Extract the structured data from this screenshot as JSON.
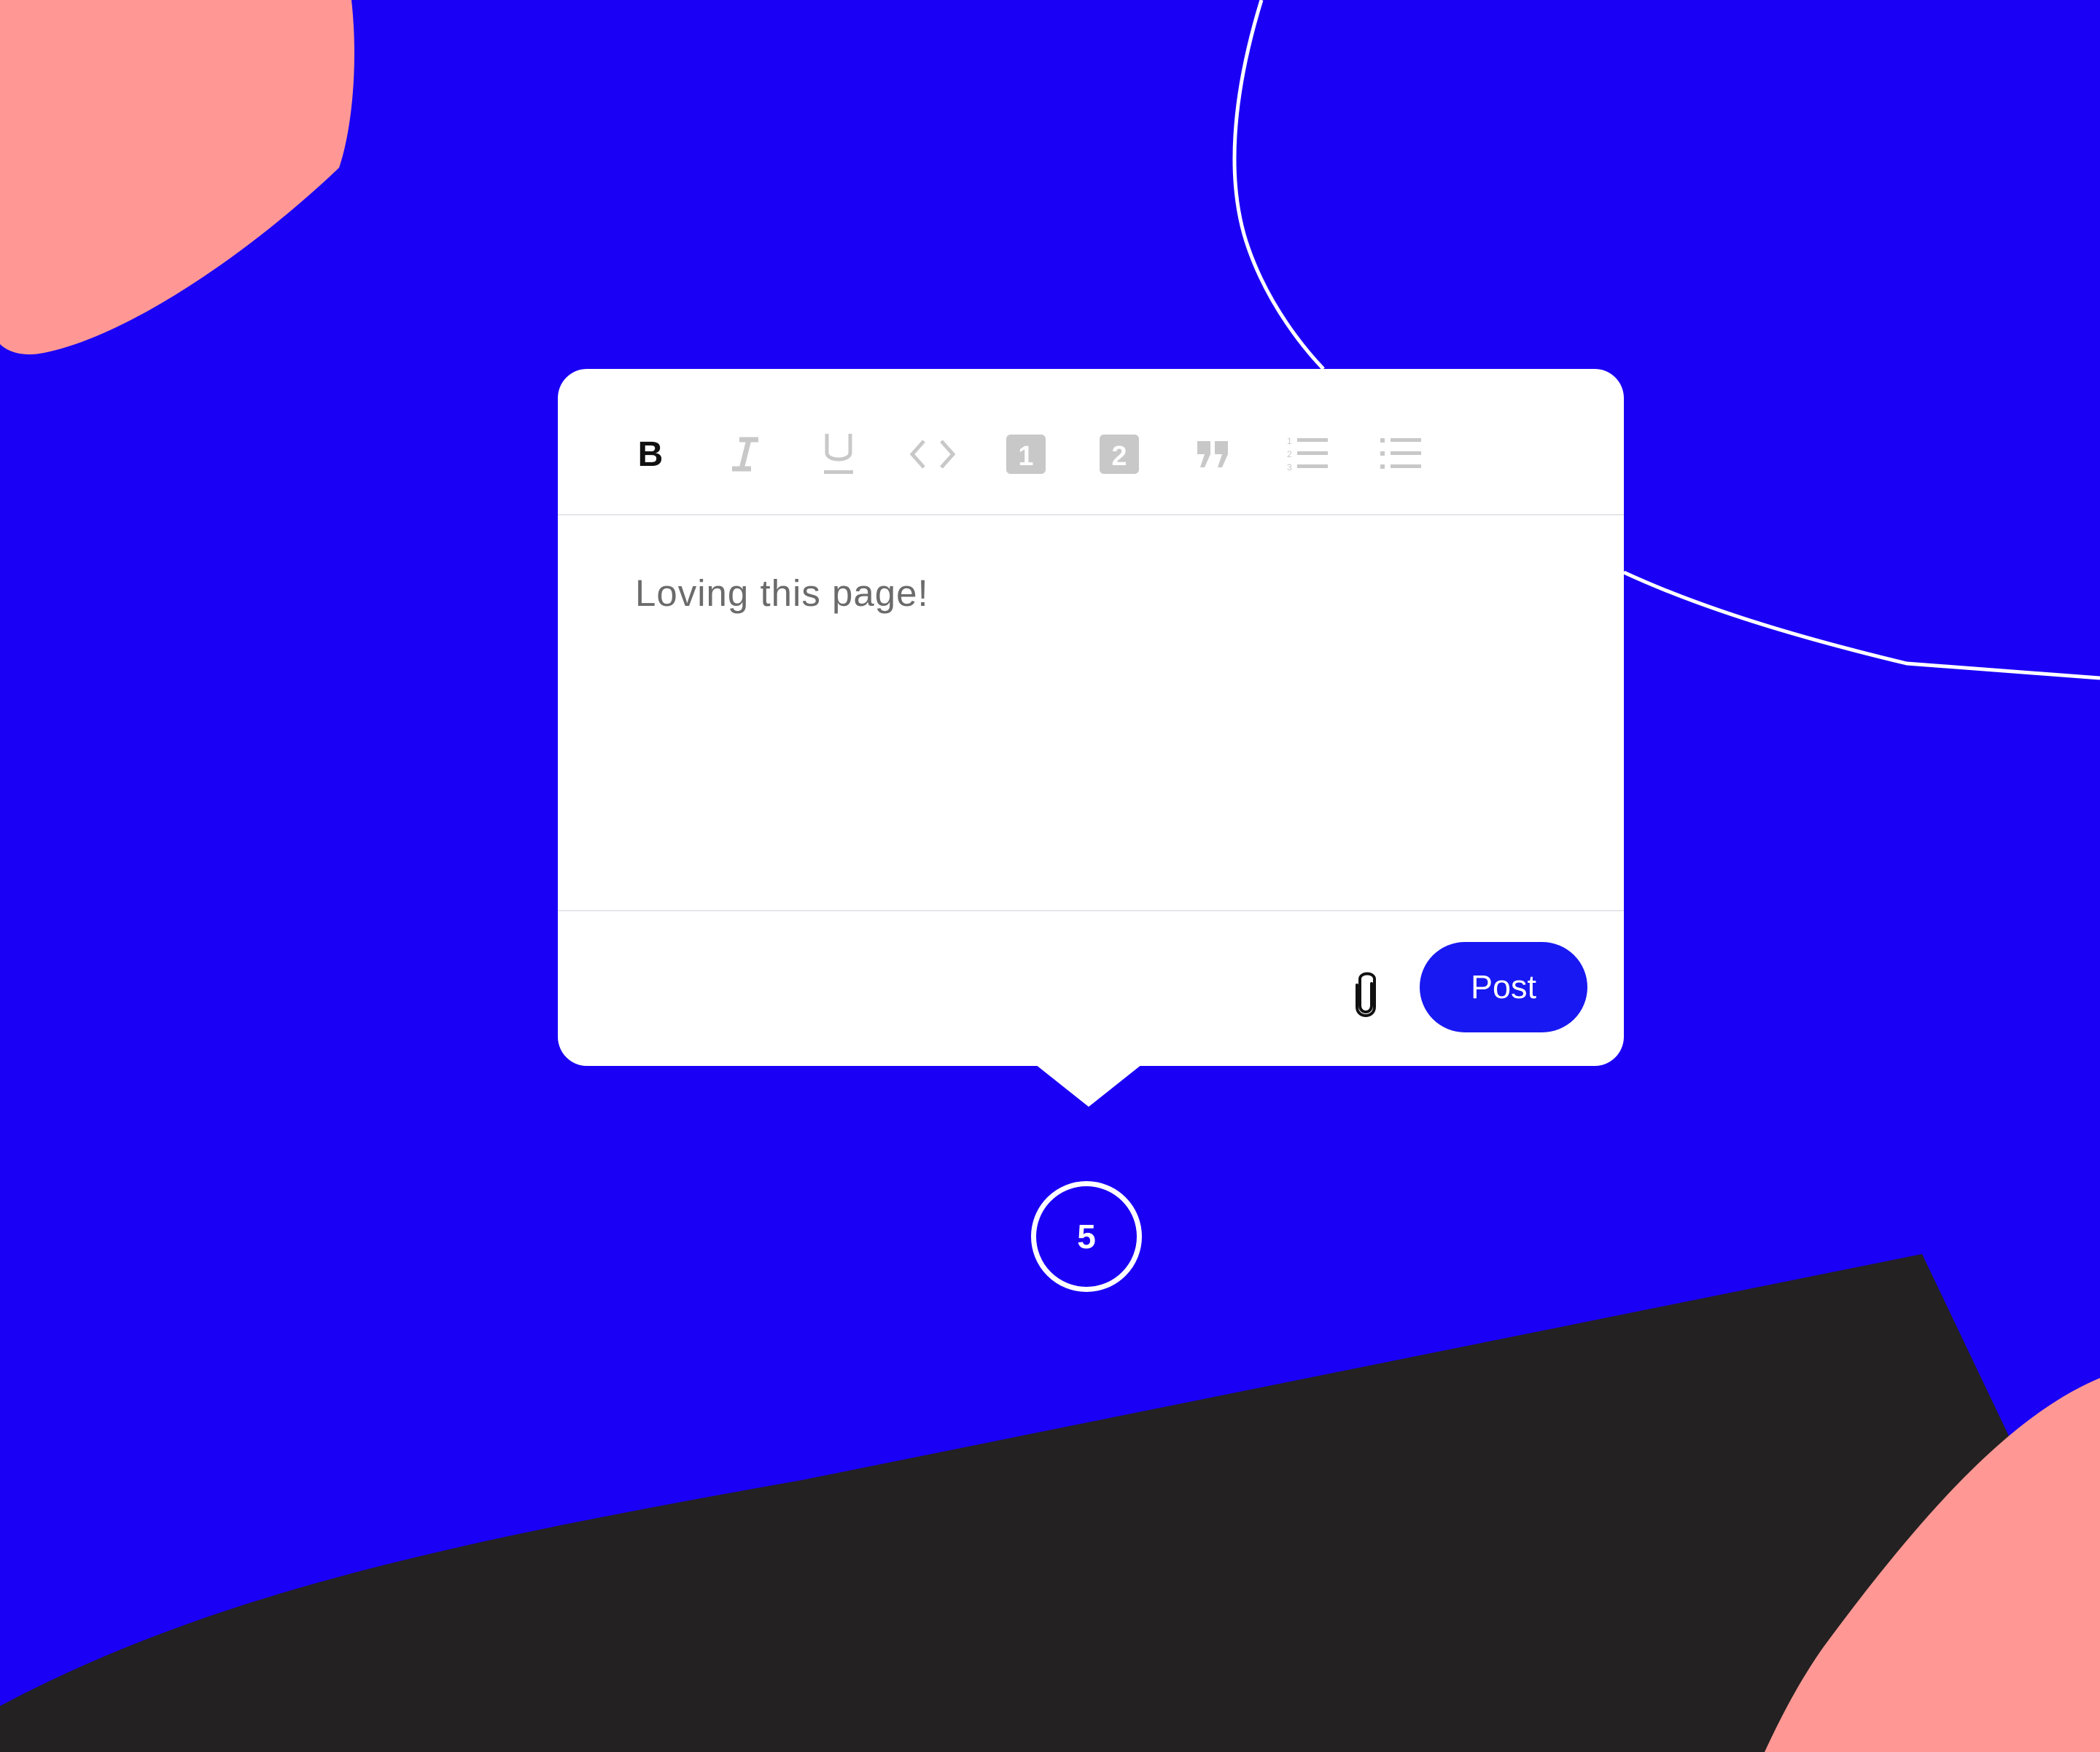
{
  "colors": {
    "background": "#1a00f5",
    "salmon": "#ff9894",
    "dark": "#232121",
    "accent": "#1818f2",
    "toolbar_inactive": "#c8c8c8",
    "toolbar_active": "#111111"
  },
  "toolbar": {
    "items": [
      {
        "name": "bold",
        "icon": "bold-icon",
        "active": true
      },
      {
        "name": "italic",
        "icon": "italic-icon",
        "active": false
      },
      {
        "name": "underline",
        "icon": "underline-icon",
        "active": false
      },
      {
        "name": "code",
        "icon": "code-icon",
        "active": false
      },
      {
        "name": "heading-1",
        "icon": "heading-1-icon",
        "active": false
      },
      {
        "name": "heading-2",
        "icon": "heading-2-icon",
        "active": false
      },
      {
        "name": "quote",
        "icon": "quote-icon",
        "active": false
      },
      {
        "name": "numbered-list",
        "icon": "numbered-list-icon",
        "active": false
      },
      {
        "name": "bulleted-list",
        "icon": "bulleted-list-icon",
        "active": false
      }
    ]
  },
  "editor": {
    "text": "Loving this page!"
  },
  "footer": {
    "attach_icon": "paperclip-icon",
    "post_label": "Post"
  },
  "step": {
    "number": "5"
  }
}
